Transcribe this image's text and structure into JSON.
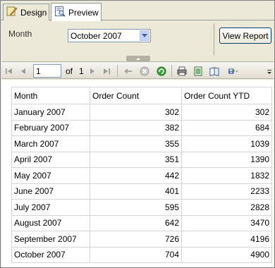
{
  "tabs": [
    {
      "label": "Design",
      "icon": "design-icon"
    },
    {
      "label": "Preview",
      "icon": "preview-icon"
    }
  ],
  "parameters": {
    "month_label": "Month",
    "month_value": "October 2007",
    "view_report_label": "View Report"
  },
  "toolbar": {
    "page_number": "1",
    "of_label": "of",
    "total_pages": "1"
  },
  "report": {
    "columns": [
      "Month",
      "Order Count",
      "Order Count YTD"
    ],
    "rows": [
      [
        "January 2007",
        "302",
        "302"
      ],
      [
        "February 2007",
        "382",
        "684"
      ],
      [
        "March 2007",
        "355",
        "1039"
      ],
      [
        "April 2007",
        "351",
        "1390"
      ],
      [
        "May 2007",
        "442",
        "1832"
      ],
      [
        "June 2007",
        "401",
        "2233"
      ],
      [
        "July 2007",
        "595",
        "2828"
      ],
      [
        "August 2007",
        "642",
        "3470"
      ],
      [
        "September 2007",
        "726",
        "4196"
      ],
      [
        "October 2007",
        "704",
        "4900"
      ]
    ]
  }
}
